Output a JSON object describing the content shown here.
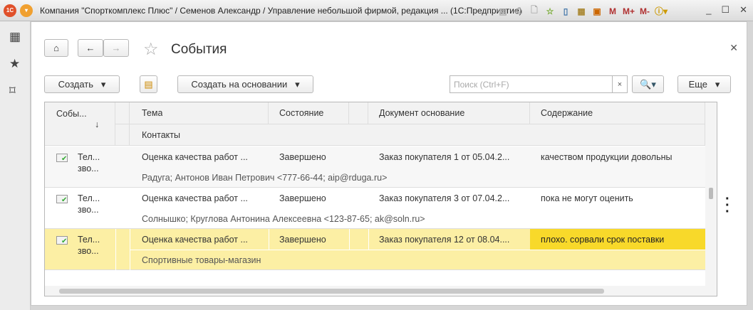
{
  "window": {
    "title": "Компания \"Спорткомплекс Плюс\" / Семенов Александр / Управление небольшой фирмой, редакция ...  (1С:Предприятие)",
    "tools": [
      "M",
      "M+",
      "M-"
    ],
    "logo": "1С"
  },
  "page": {
    "title": "События"
  },
  "toolbar": {
    "create": "Создать",
    "create_based": "Создать на основании",
    "search_placeholder": "Поиск (Ctrl+F)",
    "more": "Еще"
  },
  "table": {
    "headers": {
      "event": "Собы...",
      "sort": "↓",
      "topic": "Тема",
      "state": "Состояние",
      "document": "Документ основание",
      "content": "Содержание",
      "contacts": "Контакты"
    },
    "rows": [
      {
        "event1": "Тел...",
        "event2": "зво...",
        "topic": "Оценка качества работ ...",
        "state": "Завершено",
        "document": "Заказ покупателя 1 от 05.04.2...",
        "content": "качеством продукции довольны",
        "contacts": "Радуга; Антонов Иван Петрович <777-66-44; aip@rduga.ru>"
      },
      {
        "event1": "Тел...",
        "event2": "зво...",
        "topic": "Оценка качества работ ...",
        "state": "Завершено",
        "document": "Заказ покупателя 3 от 07.04.2...",
        "content": "пока не могут оценить",
        "contacts": "Солнышко; Круглова Антонина Алексеевна <123-87-65; ak@soln.ru>"
      },
      {
        "event1": "Тел...",
        "event2": "зво...",
        "topic": "Оценка качества работ ...",
        "state": "Завершено",
        "document": "Заказ покупателя 12 от 08.04....",
        "content": "плохо. сорвали срок поставки",
        "contacts": "Спортивные товары-магазин",
        "selected": true
      }
    ]
  }
}
